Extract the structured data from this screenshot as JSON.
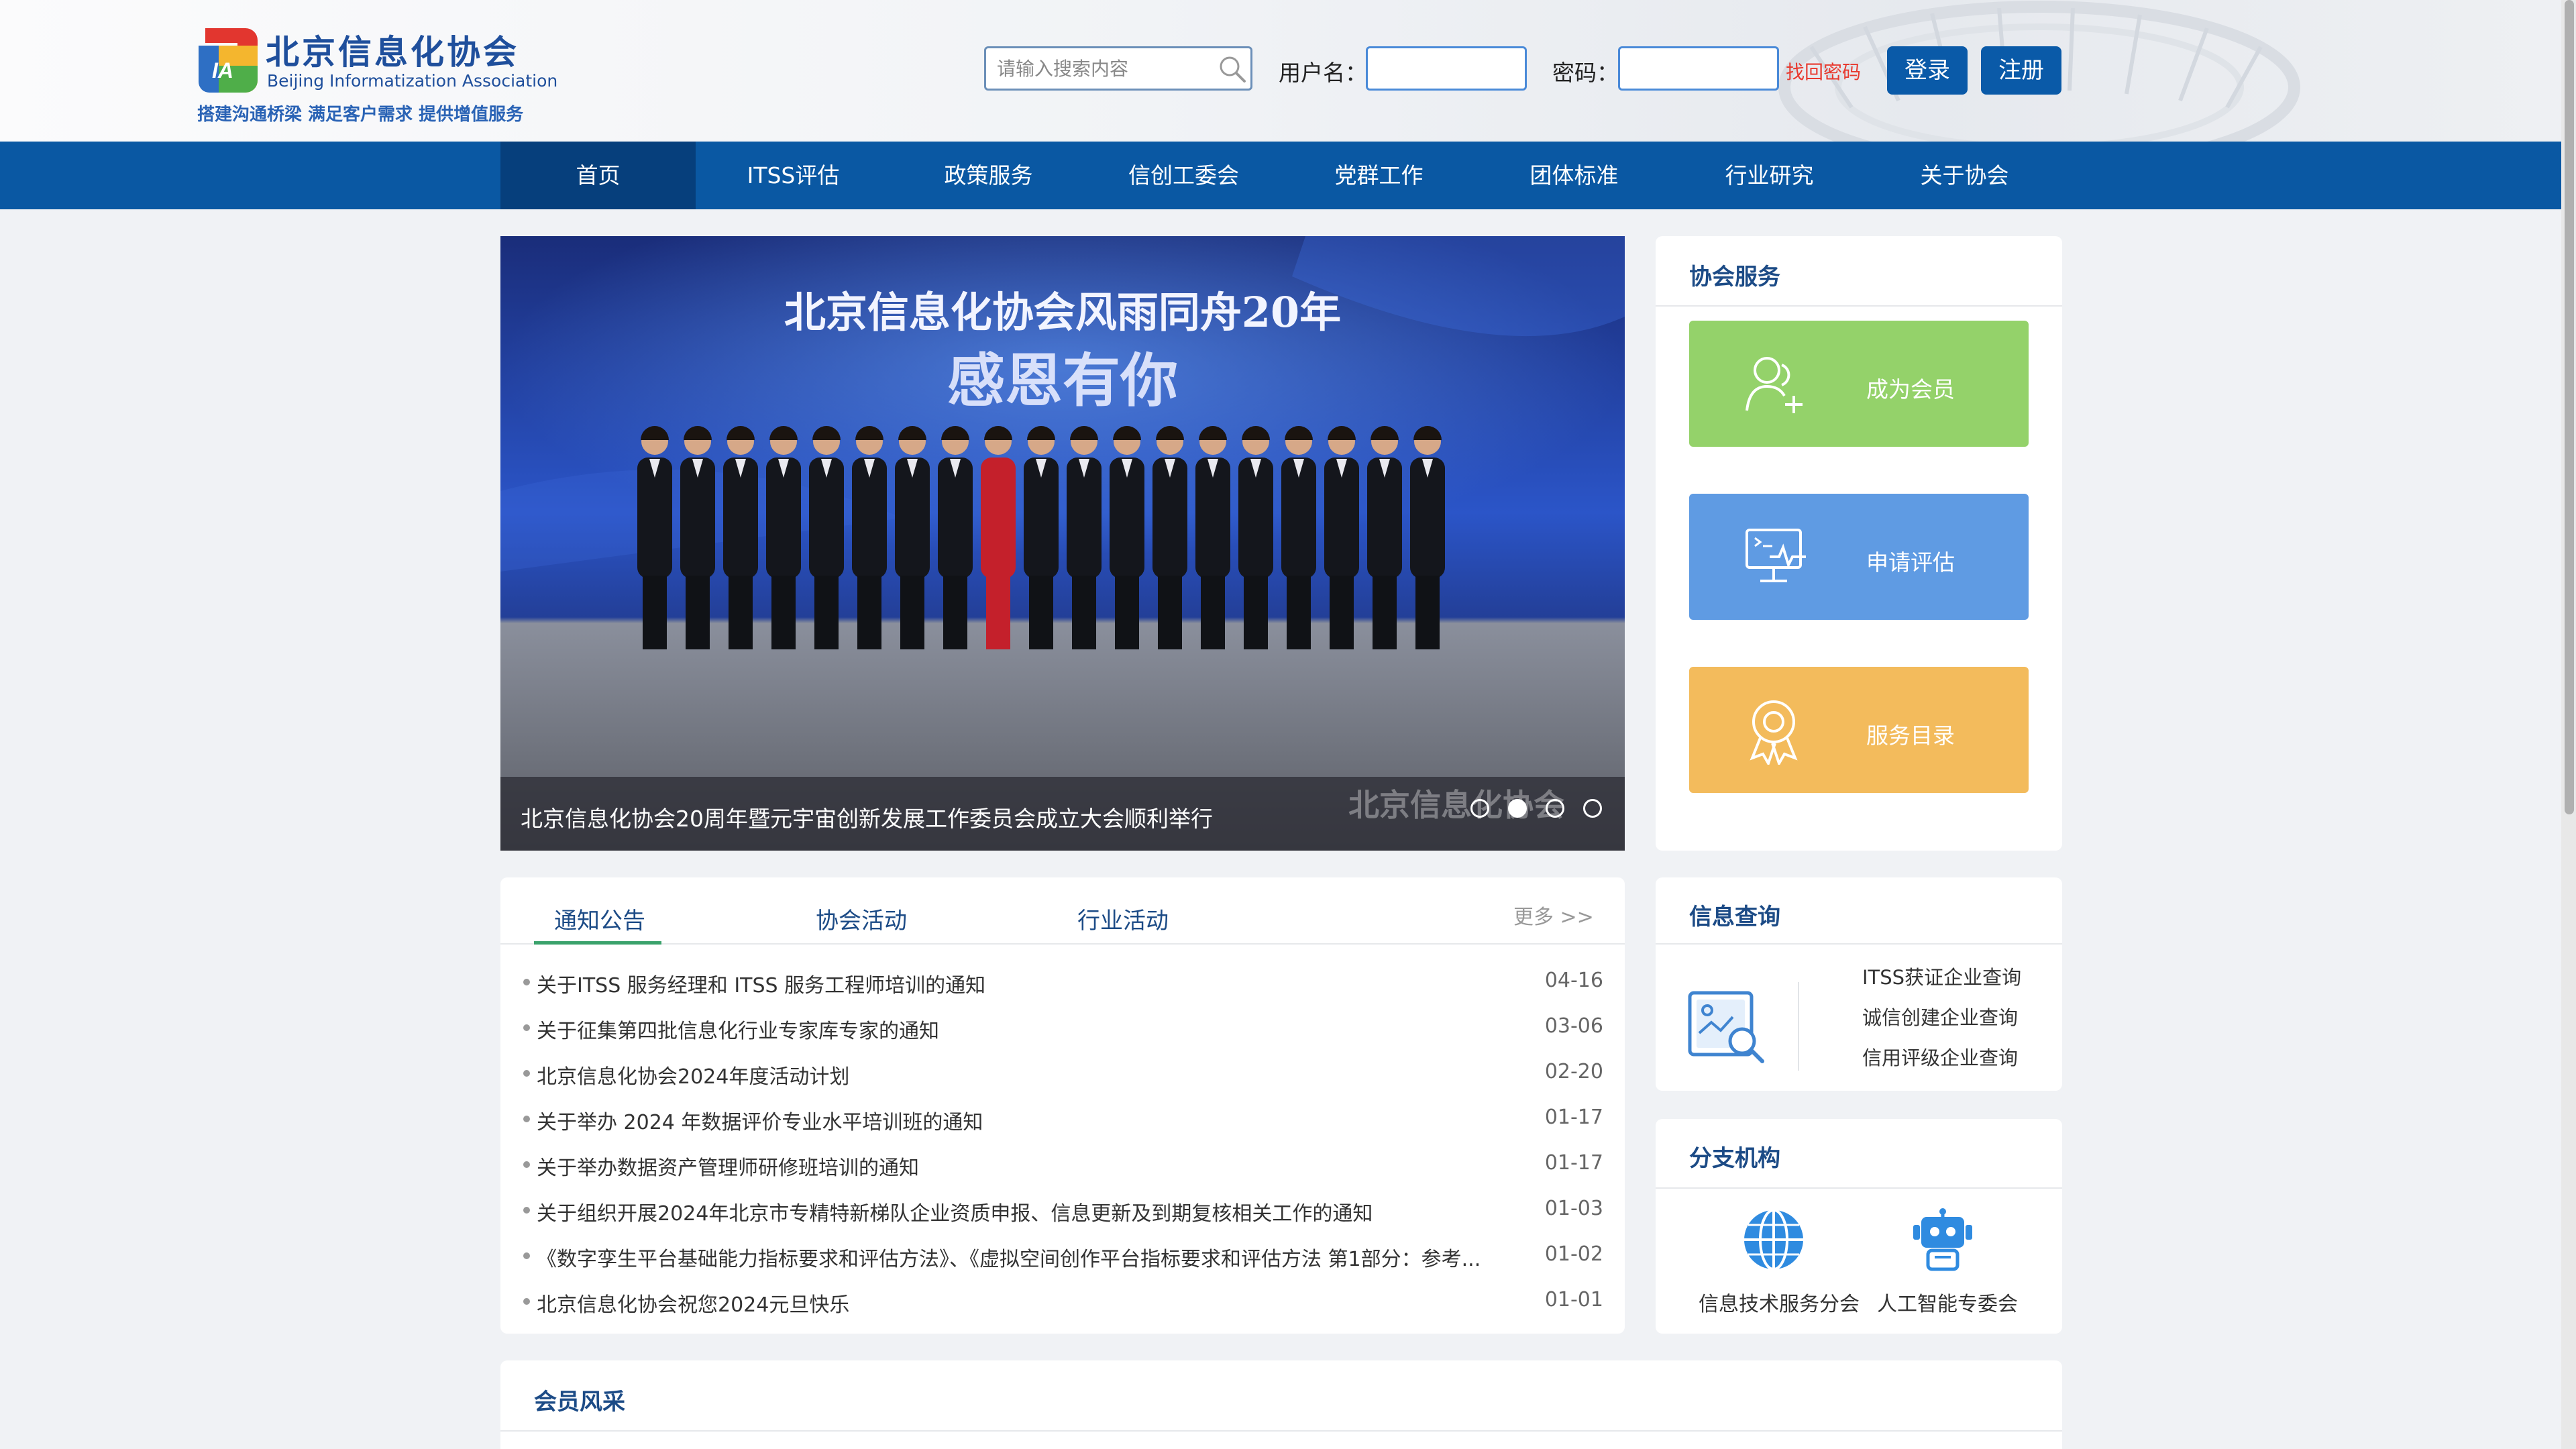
{
  "logo": {
    "name_cn": "北京信息化协会",
    "name_en": "Beijing Informatization Association",
    "slogan": "搭建沟通桥梁  满足客户需求  提供增值服务",
    "mark_text": "IA"
  },
  "search": {
    "placeholder": "请输入搜索内容",
    "icon": "magnifier"
  },
  "login": {
    "username_label": "用户名：",
    "password_label": "密码：",
    "forgot_label": "找回密码",
    "login_label": "登录",
    "register_label": "注册"
  },
  "nav": {
    "items": [
      {
        "label": "首页",
        "active": true
      },
      {
        "label": "ITSS评估"
      },
      {
        "label": "政策服务"
      },
      {
        "label": "信创工委会"
      },
      {
        "label": "党群工作"
      },
      {
        "label": "团体标准"
      },
      {
        "label": "行业研究"
      },
      {
        "label": "关于协会"
      }
    ]
  },
  "carousel": {
    "banner_line1": "北京信息化协会风雨同舟20年",
    "banner_line2": "感恩有你",
    "caption": "北京信息化协会20周年暨元宇宙创新发展工作委员会成立大会顺利举行",
    "watermark": "北京信息化协会",
    "slide_count": 4,
    "active_slide": 2
  },
  "services": {
    "title": "协会服务",
    "items": [
      {
        "label": "成为会员",
        "color": "#94d26a",
        "icon": "user-plus"
      },
      {
        "label": "申请评估",
        "color": "#5f9be3",
        "icon": "monitor-pulse"
      },
      {
        "label": "服务目录",
        "color": "#f3bb5c",
        "icon": "award-ribbon"
      }
    ]
  },
  "news": {
    "tabs": [
      {
        "label": "通知公告",
        "active": true
      },
      {
        "label": "协会活动"
      },
      {
        "label": "行业活动"
      }
    ],
    "more_label": "更多 >>",
    "items": [
      {
        "title": "关于ITSS 服务经理和 ITSS 服务工程师培训的通知",
        "date": "04-16"
      },
      {
        "title": "关于征集第四批信息化行业专家库专家的通知",
        "date": "03-06"
      },
      {
        "title": "北京信息化协会2024年度活动计划",
        "date": "02-20"
      },
      {
        "title": "关于举办 2024 年数据评价专业水平培训班的通知",
        "date": "01-17"
      },
      {
        "title": "关于举办数据资产管理师研修班培训的通知",
        "date": "01-17"
      },
      {
        "title": "关于组织开展2024年北京市专精特新梯队企业资质申报、信息更新及到期复核相关工作的通知",
        "date": "01-03"
      },
      {
        "title": "《数字孪生平台基础能力指标要求和评估方法》、《虚拟空间创作平台指标要求和评估方法 第1部分：参考...",
        "date": "01-02"
      },
      {
        "title": "北京信息化协会祝您2024元旦快乐",
        "date": "01-01"
      }
    ]
  },
  "info_query": {
    "title": "信息查询",
    "icon": "document-search",
    "links": [
      "ITSS获证企业查询",
      "诚信创建企业查询",
      "信用评级企业查询"
    ]
  },
  "branches": {
    "title": "分支机构",
    "items": [
      {
        "label": "信息技术服务分会",
        "icon": "globe-network"
      },
      {
        "label": "人工智能专委会",
        "icon": "robot"
      }
    ]
  },
  "members": {
    "title": "会员风采"
  },
  "colors": {
    "nav_bg": "#0a58a3",
    "nav_active": "#063f7c",
    "title_blue": "#1c4b86",
    "accent_green": "#3aa26b",
    "forgot_red": "#e8392e"
  }
}
